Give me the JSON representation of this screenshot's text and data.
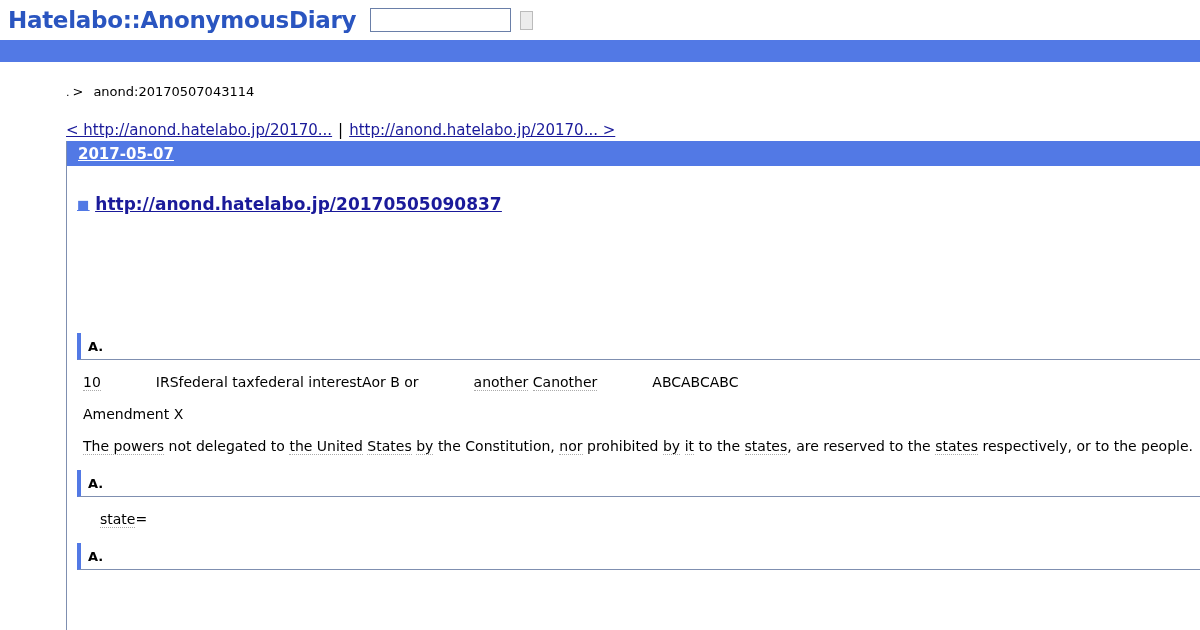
{
  "header": {
    "logo": "Hatelabo::AnonymousDiary"
  },
  "breadcrumb": {
    "separator": ".",
    "arrow": ">",
    "current": "anond:20170507043114"
  },
  "pager": {
    "previous": "< http://anond.hatelabo.jp/20170...",
    "divider": "|",
    "next": "http://anond.hatelabo.jp/20170... >"
  },
  "day": {
    "date": "2017-05-07",
    "title_mark": "■",
    "title": "http://anond.hatelabo.jp/20170505090837",
    "sections": [
      {
        "heading": "A.",
        "paragraphs": [
          {
            "indent": false,
            "segments": [
              {
                "text": "10",
                "keyword": true,
                "space_before": false,
                "gap_before": false
              },
              {
                "text": "IRSfederal taxfederal interestAor B or",
                "keyword": false,
                "space_before": false,
                "gap_before": true
              },
              {
                "text": "another",
                "keyword": true,
                "space_before": false,
                "gap_before": true
              },
              {
                "text": "Canother",
                "keyword": true,
                "space_before": true,
                "gap_before": false
              },
              {
                "text": "ABCABCABC",
                "keyword": false,
                "space_before": false,
                "gap_before": true
              }
            ]
          },
          {
            "indent": false,
            "segments": [
              {
                "text": "Amendment X",
                "keyword": false,
                "space_before": false,
                "gap_before": false
              }
            ]
          },
          {
            "indent": false,
            "segments": [
              {
                "text": "The powers",
                "keyword": true,
                "space_before": false,
                "gap_before": false
              },
              {
                "text": "not delegated to",
                "keyword": false,
                "space_before": true,
                "gap_before": false
              },
              {
                "text": "the United",
                "keyword": true,
                "space_before": true,
                "gap_before": false
              },
              {
                "text": "States",
                "keyword": true,
                "space_before": true,
                "gap_before": false
              },
              {
                "text": "by",
                "keyword": true,
                "space_before": true,
                "gap_before": false
              },
              {
                "text": "the Constitution,",
                "keyword": false,
                "space_before": true,
                "gap_before": false
              },
              {
                "text": "nor",
                "keyword": true,
                "space_before": true,
                "gap_before": false
              },
              {
                "text": "prohibited",
                "keyword": false,
                "space_before": true,
                "gap_before": false
              },
              {
                "text": "by",
                "keyword": true,
                "space_before": true,
                "gap_before": false
              },
              {
                "text": "it",
                "keyword": true,
                "space_before": true,
                "gap_before": false
              },
              {
                "text": "to the",
                "keyword": false,
                "space_before": true,
                "gap_before": false
              },
              {
                "text": "states",
                "keyword": true,
                "space_before": true,
                "gap_before": false
              },
              {
                "text": ", are reserved to the",
                "keyword": false,
                "space_before": false,
                "gap_before": false
              },
              {
                "text": "states",
                "keyword": true,
                "space_before": true,
                "gap_before": false
              },
              {
                "text": "respectively, or to the people.",
                "keyword": false,
                "space_before": true,
                "gap_before": false
              }
            ]
          }
        ]
      },
      {
        "heading": "A.",
        "paragraphs": [
          {
            "indent": true,
            "segments": [
              {
                "text": "state",
                "keyword": true,
                "space_before": false,
                "gap_before": false
              },
              {
                "text": "=",
                "keyword": false,
                "space_before": false,
                "gap_before": false
              }
            ]
          }
        ]
      },
      {
        "heading": "A."
      }
    ]
  }
}
